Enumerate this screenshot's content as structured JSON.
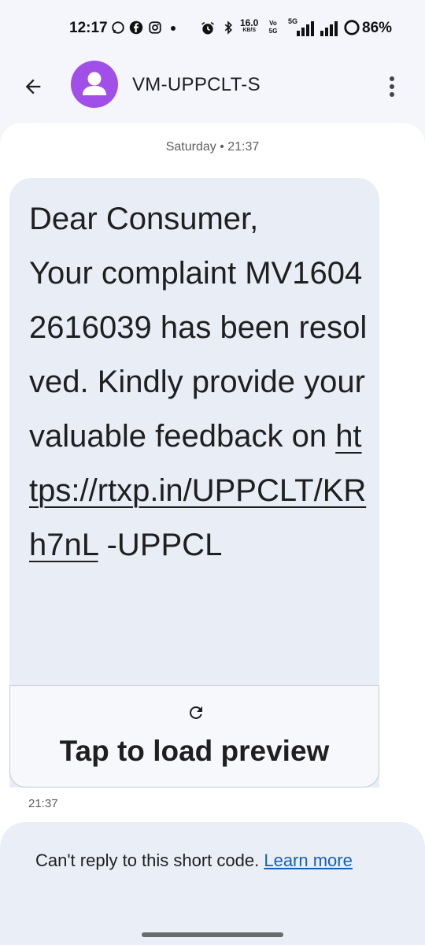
{
  "status_bar": {
    "time": "12:17",
    "net_speed_value": "16.0",
    "net_speed_unit": "KB/S",
    "volte": "Vo 5G",
    "network": "5G",
    "battery": "86%",
    "icons": [
      "whatsapp-icon",
      "facebook-icon",
      "instagram-icon",
      "alarm-icon",
      "bluetooth-icon",
      "signal-icon",
      "signal-icon",
      "battery-icon"
    ]
  },
  "header": {
    "contact_name": "VM-UPPCLT-S",
    "avatar_color": "#a050e8"
  },
  "conversation": {
    "date_separator": "Saturday • 21:37",
    "message": {
      "text_before_link": "Dear Consumer,\nYour complaint MV16042616039 has been resolved. Kindly provide your valuable feedback on ",
      "link": "https://rtxp.in/UPPCLT/KRh7nL",
      "text_after_link": " -UPPCL",
      "time": "21:37"
    },
    "preview": {
      "label": "Tap to load preview"
    }
  },
  "reply_notice": {
    "text": "Can't reply to this short code. ",
    "link_label": "Learn more"
  },
  "colors": {
    "bubble": "#e8edf6",
    "link": "#1a5fb4",
    "background": "#f4f6fb"
  }
}
